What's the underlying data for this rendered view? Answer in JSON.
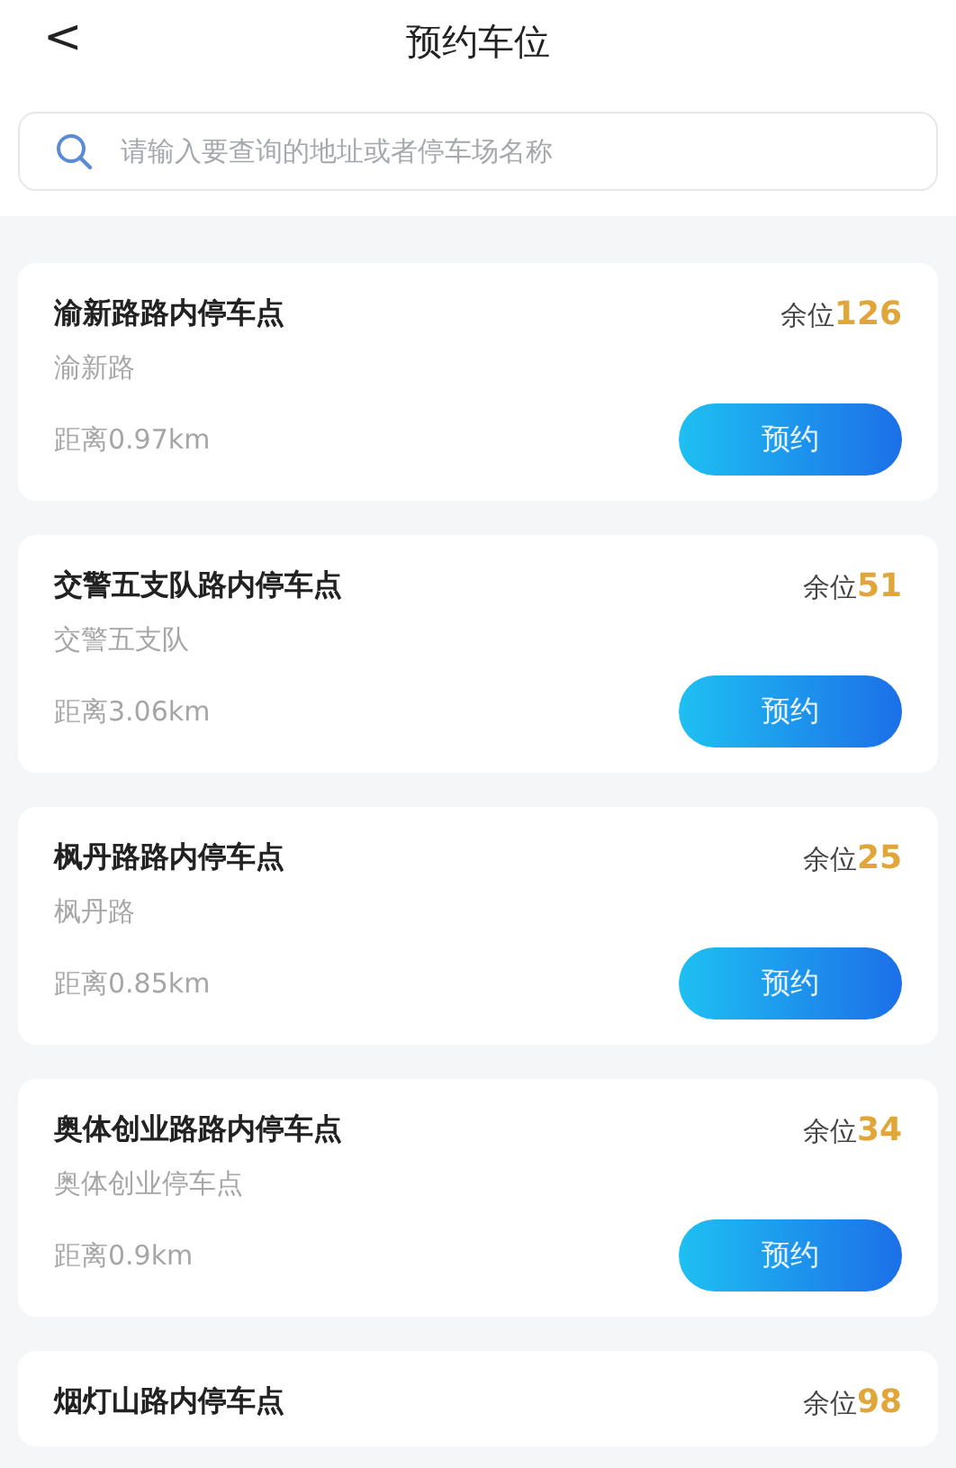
{
  "header": {
    "back": "<",
    "title": "预约车位"
  },
  "search": {
    "placeholder": "请输入要查询的地址或者停车场名称"
  },
  "lots": [
    {
      "name": "渝新路路内停车点",
      "free_label": "余位",
      "free": "126",
      "address": "渝新路",
      "distance": "距离0.97km",
      "button": "预约"
    },
    {
      "name": "交警五支队路内停车点",
      "free_label": "余位",
      "free": "51",
      "address": "交警五支队",
      "distance": "距离3.06km",
      "button": "预约"
    },
    {
      "name": "枫丹路路内停车点",
      "free_label": "余位",
      "free": "25",
      "address": "枫丹路",
      "distance": "距离0.85km",
      "button": "预约"
    },
    {
      "name": "奥体创业路路内停车点",
      "free_label": "余位",
      "free": "34",
      "address": "奥体创业停车点",
      "distance": "距离0.9km",
      "button": "预约"
    },
    {
      "name": "烟灯山路内停车点",
      "free_label": "余位",
      "free": "98"
    }
  ]
}
